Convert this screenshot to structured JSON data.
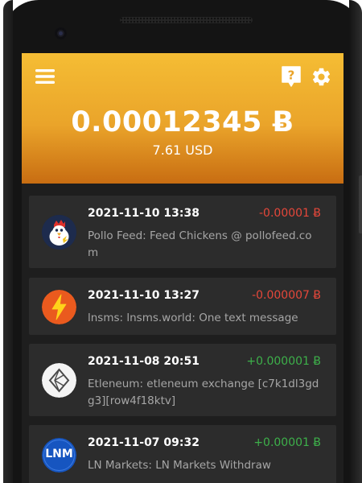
{
  "header": {
    "balance": "0.00012345 Ƀ",
    "fiat": "7.61 USD",
    "menu_icon": "hamburger-menu-icon",
    "help_icon": "help-question-icon",
    "settings_icon": "gear-icon"
  },
  "colors": {
    "header_top": "#f5bd34",
    "header_bottom": "#c86d12",
    "negative": "#e5473a",
    "positive": "#3db04a",
    "card_bg": "#2c2c2c",
    "screen_bg": "#1e1e1e"
  },
  "transactions": [
    {
      "date": "2021-11-10 13:38",
      "amount": "-0.00001 Ƀ",
      "direction": "out",
      "description": "Pollo Feed: Feed Chickens @ pollofeed.com",
      "icon": "pollo-feed-chicken-icon"
    },
    {
      "date": "2021-11-10 13:27",
      "amount": "-0.000007 Ƀ",
      "direction": "out",
      "description": "lnsms: lnsms.world: One text message",
      "icon": "lnsms-lightning-icon"
    },
    {
      "date": "2021-11-08 20:51",
      "amount": "+0.000001 Ƀ",
      "direction": "in",
      "description": "Etleneum: etleneum exchange [c7k1dl3gdg3][row4f18ktv]",
      "icon": "etleneum-logo-icon"
    },
    {
      "date": "2021-11-07 09:32",
      "amount": "+0.00001 Ƀ",
      "direction": "in",
      "description": "LN Markets: LN Markets Withdraw",
      "icon": "ln-markets-logo-icon",
      "logo_text": "LNM"
    }
  ]
}
